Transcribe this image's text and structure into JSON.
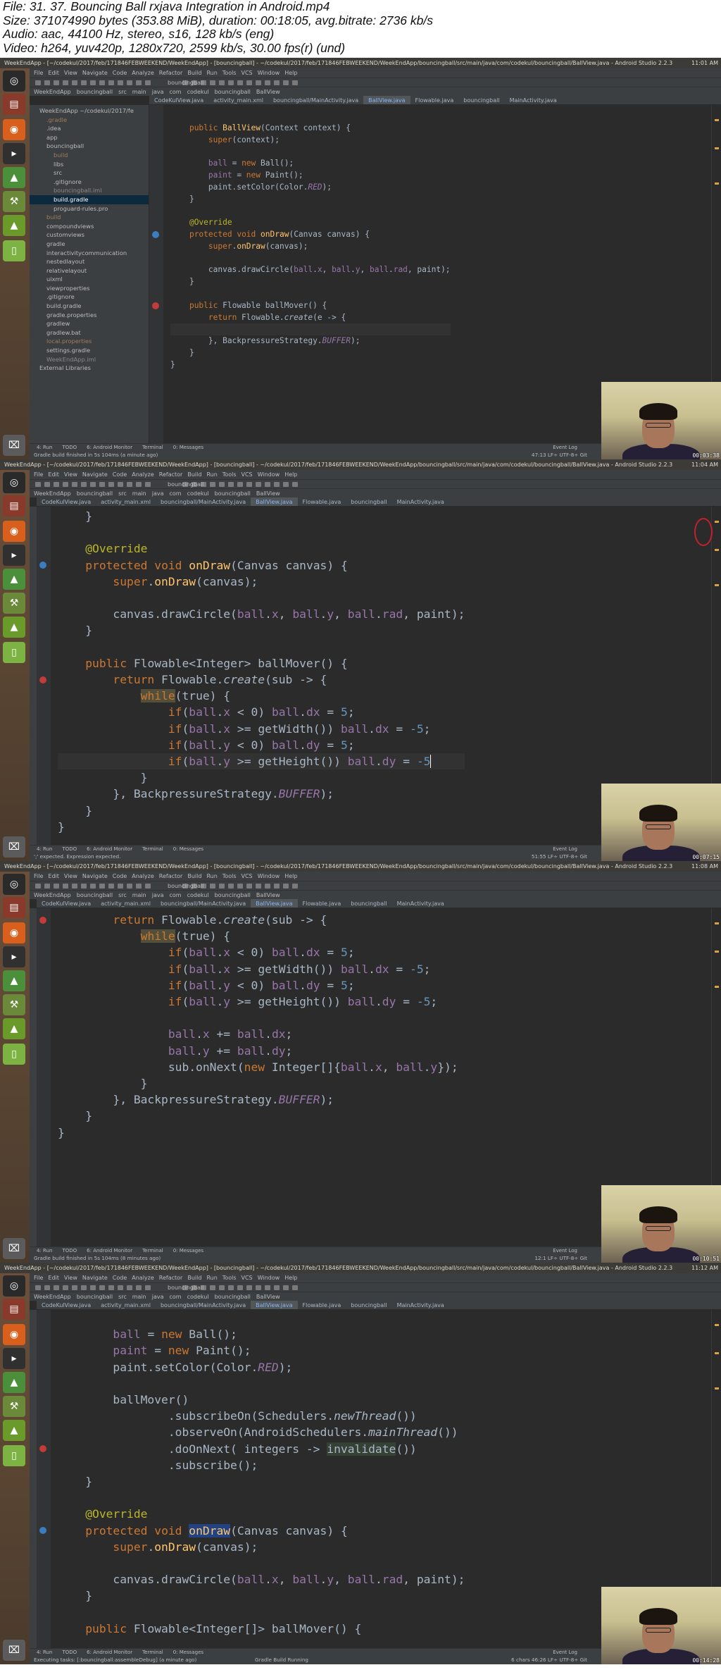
{
  "file_info": {
    "lines": [
      "File: 31. 37. Bouncing Ball rxjava Integration in Android.mp4",
      "Size: 371074990 bytes (353.88 MiB), duration: 00:18:05, avg.bitrate: 2736 kb/s",
      "Audio: aac, 44100 Hz, stereo, s16, 128 kb/s (eng)",
      "Video: h264, yuv420p, 1280x720, 2599 kb/s, 30.00 fps(r) (und)"
    ]
  },
  "ide": {
    "title": "WeekEndApp - [~/codekul/2017/feb/171846FEBWEEKEND/WeekEndApp] - [bouncingball] - ~/codekul/2017/feb/171846FEBWEEKEND/WeekEndApp/bouncingball/src/main/java/com/codekul/bouncingball/BallView.java - Android Studio 2.2.3",
    "menu": [
      "File",
      "Edit",
      "View",
      "Navigate",
      "Code",
      "Analyze",
      "Refactor",
      "Build",
      "Run",
      "Tools",
      "VCS",
      "Window",
      "Help"
    ],
    "breadcrumb": [
      "WeekEndApp",
      "bouncingball",
      "src",
      "main",
      "java",
      "com",
      "codekul",
      "bouncingball",
      "BallView"
    ],
    "run_config": "bouncingball",
    "bottom_tools": [
      "4: Run",
      "TODO",
      "6: Android Monitor",
      "Terminal",
      "0: Messages"
    ],
    "event_log": "Event Log",
    "project_tree": [
      {
        "label": "WeekEndApp  ~/codekul/2017/fe",
        "indent": 0
      },
      {
        "label": ".gradle",
        "indent": 1,
        "style": "excl"
      },
      {
        "label": ".idea",
        "indent": 1
      },
      {
        "label": "app",
        "indent": 1
      },
      {
        "label": "bouncingball",
        "indent": 1
      },
      {
        "label": "build",
        "indent": 2,
        "style": "excl"
      },
      {
        "label": "libs",
        "indent": 2
      },
      {
        "label": "src",
        "indent": 2
      },
      {
        "label": ".gitignore",
        "indent": 2
      },
      {
        "label": "bouncingball.iml",
        "indent": 2,
        "style": "gen"
      },
      {
        "label": "build.gradle",
        "indent": 2,
        "style": "sel"
      },
      {
        "label": "proguard-rules.pro",
        "indent": 2
      },
      {
        "label": "build",
        "indent": 1,
        "style": "excl"
      },
      {
        "label": "compoundviews",
        "indent": 1
      },
      {
        "label": "customviews",
        "indent": 1
      },
      {
        "label": "gradle",
        "indent": 1
      },
      {
        "label": "interactivitycommunication",
        "indent": 1
      },
      {
        "label": "nestedlayout",
        "indent": 1
      },
      {
        "label": "relativelayout",
        "indent": 1
      },
      {
        "label": "uixml",
        "indent": 1
      },
      {
        "label": "viewproperties",
        "indent": 1
      },
      {
        "label": ".gitignore",
        "indent": 1
      },
      {
        "label": "build.gradle",
        "indent": 1
      },
      {
        "label": "gradle.properties",
        "indent": 1
      },
      {
        "label": "gradlew",
        "indent": 1
      },
      {
        "label": "gradlew.bat",
        "indent": 1
      },
      {
        "label": "local.properties",
        "indent": 1,
        "style": "excl"
      },
      {
        "label": "settings.gradle",
        "indent": 1
      },
      {
        "label": "WeekEndApp.iml",
        "indent": 1,
        "style": "gen"
      },
      {
        "label": "External Libraries",
        "indent": 0
      }
    ]
  },
  "frames": [
    {
      "tray_time": "11:01 AM",
      "tabs": [
        "CodeKulView.java",
        "activity_main.xml",
        "bouncingball/MainActivity.java",
        "BallView.java",
        "Flowable.java",
        "bouncingball",
        "MainActivity.java"
      ],
      "active_tab": 3,
      "status": "Gradle build finished in 5s 104ms (a minute ago)",
      "position": "47:13  LF÷  UTF-8÷  Git",
      "webcam_time": "00:03:38",
      "code": [
        "",
        "    public BallView(Context context) {",
        "        super(context);",
        "",
        "        ball = new Ball();",
        "        paint = new Paint();",
        "        paint.setColor(Color.RED);",
        "    }",
        "",
        "    @Override",
        "    protected void onDraw(Canvas canvas) {",
        "        super.onDraw(canvas);",
        "",
        "        canvas.drawCircle(ball.x, ball.y, ball.rad, paint);",
        "    }",
        "",
        "    public Flowable ballMover() {",
        "        return Flowable.create(e -> {",
        "",
        "        }, BackpressureStrategy.BUFFER);",
        "    }",
        "}"
      ]
    },
    {
      "tray_time": "11:04 AM",
      "tabs": [
        "CodeKulView.java",
        "activity_main.xml",
        "bouncingball/MainActivity.java",
        "BallView.java",
        "Flowable.java",
        "bouncingball",
        "MainActivity.java"
      ],
      "active_tab": 3,
      "status": "';' expected. Expression expected.",
      "position": "51:55  LF÷  UTF-8÷  Git",
      "webcam_time": "00:07:15",
      "code": [
        "    }",
        "",
        "    @Override",
        "    protected void onDraw(Canvas canvas) {",
        "        super.onDraw(canvas);",
        "",
        "        canvas.drawCircle(ball.x, ball.y, ball.rad, paint);",
        "    }",
        "",
        "    public Flowable<Integer> ballMover() {",
        "        return Flowable.create(sub -> {",
        "            while(true) {",
        "                if(ball.x < 0) ball.dx = 5;",
        "                if(ball.x >= getWidth()) ball.dx = -5;",
        "                if(ball.y < 0) ball.dy = 5;",
        "                if(ball.y >= getHeight()) ball.dy = -5",
        "            }",
        "        }, BackpressureStrategy.BUFFER);",
        "    }",
        "}"
      ]
    },
    {
      "tray_time": "11:08 AM",
      "tabs": [
        "CodeKulView.java",
        "activity_main.xml",
        "bouncingball/MainActivity.java",
        "BallView.java",
        "Flowable.java",
        "bouncingball",
        "MainActivity.java"
      ],
      "active_tab": 3,
      "status": "Gradle build finished in 5s 104ms (8 minutes ago)",
      "position": "12:1  LF÷  UTF-8÷  Git",
      "webcam_time": "00:10:51",
      "code": [
        "        return Flowable.create(sub -> {",
        "            while(true) {",
        "                if(ball.x < 0) ball.dx = 5;",
        "                if(ball.x >= getWidth()) ball.dx = -5;",
        "                if(ball.y < 0) ball.dy = 5;",
        "                if(ball.y >= getHeight()) ball.dy = -5;",
        "",
        "                ball.x += ball.dx;",
        "                ball.y += ball.dy;",
        "                sub.onNext(new Integer[]{ball.x, ball.y});",
        "            }",
        "        }, BackpressureStrategy.BUFFER);",
        "    }",
        "}"
      ]
    },
    {
      "tray_time": "11:12 AM",
      "tabs": [
        "CodeKulView.java",
        "activity_main.xml",
        "bouncingball/MainActivity.java",
        "BallView.java",
        "Flowable.java",
        "bouncingball",
        "MainActivity.java"
      ],
      "active_tab": 3,
      "status": "Executing tasks: [:bouncingball:assembleDebug] (a minute ago)",
      "position": "6 chars  46:26  LF÷  UTF-8÷  Git",
      "build_running": "Gradle Build Running",
      "webcam_time": "00:14:28",
      "code": [
        "",
        "        ball = new Ball();",
        "        paint = new Paint();",
        "        paint.setColor(Color.RED);",
        "",
        "        ballMover()",
        "                .subscribeOn(Schedulers.newThread())",
        "                .observeOn(AndroidSchedulers.mainThread())",
        "                .doOnNext( integers -> invalidate())",
        "                .subscribe();",
        "    }",
        "",
        "    @Override",
        "    protected void onDraw(Canvas canvas) {",
        "        super.onDraw(canvas);",
        "",
        "        canvas.drawCircle(ball.x, ball.y, ball.rad, paint);",
        "    }",
        "",
        "    public Flowable<Integer[]> ballMover() {"
      ]
    }
  ],
  "colors": {
    "editor_bg": "#2b2b2b",
    "keyword": "#cc7832",
    "method_decl": "#ffc66d",
    "number": "#6897bb",
    "field": "#9876aa",
    "annotation": "#bbb529",
    "text": "#a9b7c6"
  }
}
